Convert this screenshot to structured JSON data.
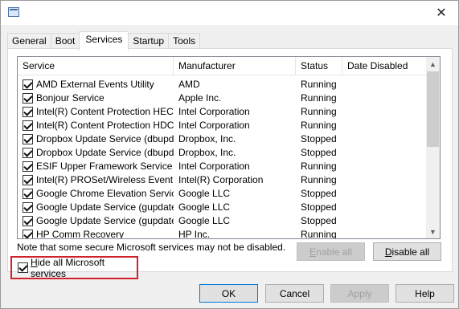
{
  "tabs": [
    "General",
    "Boot",
    "Services",
    "Startup",
    "Tools"
  ],
  "active_tab": "Services",
  "columns": [
    "Service",
    "Manufacturer",
    "Status",
    "Date Disabled"
  ],
  "services": [
    {
      "name": "AMD External Events Utility",
      "manufacturer": "AMD",
      "status": "Running",
      "date_disabled": "",
      "checked": true
    },
    {
      "name": "Bonjour Service",
      "manufacturer": "Apple Inc.",
      "status": "Running",
      "date_disabled": "",
      "checked": true
    },
    {
      "name": "Intel(R) Content Protection HEC...",
      "manufacturer": "Intel Corporation",
      "status": "Running",
      "date_disabled": "",
      "checked": true
    },
    {
      "name": "Intel(R) Content Protection HDC...",
      "manufacturer": "Intel Corporation",
      "status": "Running",
      "date_disabled": "",
      "checked": true
    },
    {
      "name": "Dropbox Update Service (dbupd...",
      "manufacturer": "Dropbox, Inc.",
      "status": "Stopped",
      "date_disabled": "",
      "checked": true
    },
    {
      "name": "Dropbox Update Service (dbupd...",
      "manufacturer": "Dropbox, Inc.",
      "status": "Stopped",
      "date_disabled": "",
      "checked": true
    },
    {
      "name": "ESIF Upper Framework Service",
      "manufacturer": "Intel Corporation",
      "status": "Running",
      "date_disabled": "",
      "checked": true
    },
    {
      "name": "Intel(R) PROSet/Wireless Event ...",
      "manufacturer": "Intel(R) Corporation",
      "status": "Running",
      "date_disabled": "",
      "checked": true
    },
    {
      "name": "Google Chrome Elevation Service",
      "manufacturer": "Google LLC",
      "status": "Stopped",
      "date_disabled": "",
      "checked": true
    },
    {
      "name": "Google Update Service (gupdate)",
      "manufacturer": "Google LLC",
      "status": "Stopped",
      "date_disabled": "",
      "checked": true
    },
    {
      "name": "Google Update Service (gupdatem)",
      "manufacturer": "Google LLC",
      "status": "Stopped",
      "date_disabled": "",
      "checked": true
    },
    {
      "name": "HP Comm Recovery",
      "manufacturer": "HP Inc.",
      "status": "Running",
      "date_disabled": "",
      "checked": true
    }
  ],
  "note": "Note that some secure Microsoft services may not be disabled.",
  "enable_all": {
    "prefix": "",
    "accel": "E",
    "rest": "nable all"
  },
  "disable_all": {
    "prefix": "",
    "accel": "D",
    "rest": "isable all"
  },
  "hide_ms": {
    "prefix": "",
    "accel": "H",
    "rest": "ide all Microsoft services",
    "checked": true
  },
  "buttons": {
    "ok": "OK",
    "cancel": "Cancel",
    "apply": "Apply",
    "help": "Help"
  },
  "icons": {
    "close": "close-icon",
    "app": "msconfig-app-icon",
    "scroll_up": "scroll-up-arrow-icon",
    "scroll_down": "scroll-down-arrow-icon"
  }
}
